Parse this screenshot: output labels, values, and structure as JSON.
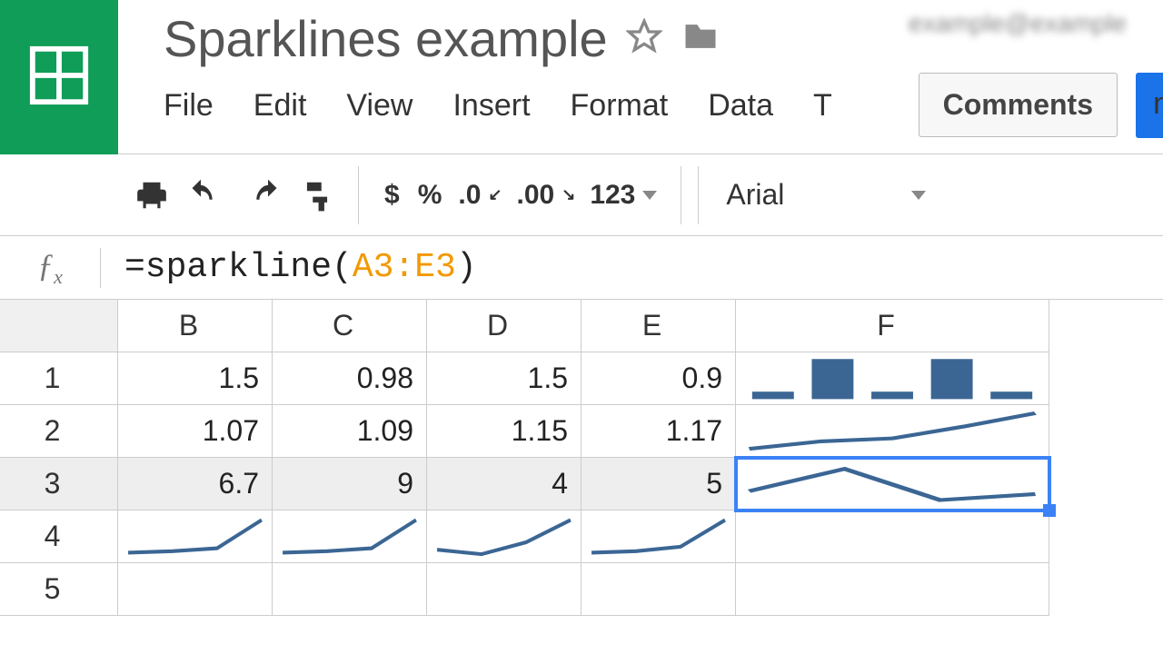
{
  "header": {
    "title": "Sparklines example",
    "user_identity": "example@example",
    "comments_label": "Comments"
  },
  "menu": [
    "File",
    "Edit",
    "View",
    "Insert",
    "Format",
    "Data",
    "T"
  ],
  "toolbar": {
    "currency": "$",
    "percent": "%",
    "dec_dec": ".0",
    "inc_dec": ".00",
    "num_format": "123",
    "font": "Arial"
  },
  "formula": {
    "fx": "fx",
    "pre": "=sparkline(",
    "ref": "A3:E3",
    "post": ")"
  },
  "columns": [
    "B",
    "C",
    "D",
    "E",
    "F"
  ],
  "rows": [
    "1",
    "2",
    "3",
    "4",
    "5"
  ],
  "cells": {
    "r1": {
      "B": "1.5",
      "C": "0.98",
      "D": "1.5",
      "E": "0.9"
    },
    "r2": {
      "B": "1.07",
      "C": "1.09",
      "D": "1.15",
      "E": "1.17"
    },
    "r3": {
      "B": "6.7",
      "C": "9",
      "D": "4",
      "E": "5"
    }
  },
  "chart_data": [
    {
      "type": "bar",
      "cell": "F1",
      "values": [
        0.2,
        1.0,
        0.2,
        1.0,
        0.2
      ]
    },
    {
      "type": "line",
      "cell": "F2",
      "values": [
        1.0,
        1.07,
        1.09,
        1.15,
        1.17
      ]
    },
    {
      "type": "line",
      "cell": "F3",
      "values": [
        6.7,
        9,
        4,
        5
      ]
    },
    {
      "type": "line",
      "cell": "B4",
      "values": [
        0.3,
        0.32,
        0.35,
        1.0
      ]
    },
    {
      "type": "line",
      "cell": "C4",
      "values": [
        0.3,
        0.32,
        0.35,
        1.0
      ]
    },
    {
      "type": "line",
      "cell": "D4",
      "values": [
        0.3,
        0.25,
        0.45,
        1.0
      ]
    },
    {
      "type": "line",
      "cell": "E4",
      "values": [
        0.3,
        0.32,
        0.4,
        1.0
      ]
    }
  ],
  "selected_cell": "F3"
}
